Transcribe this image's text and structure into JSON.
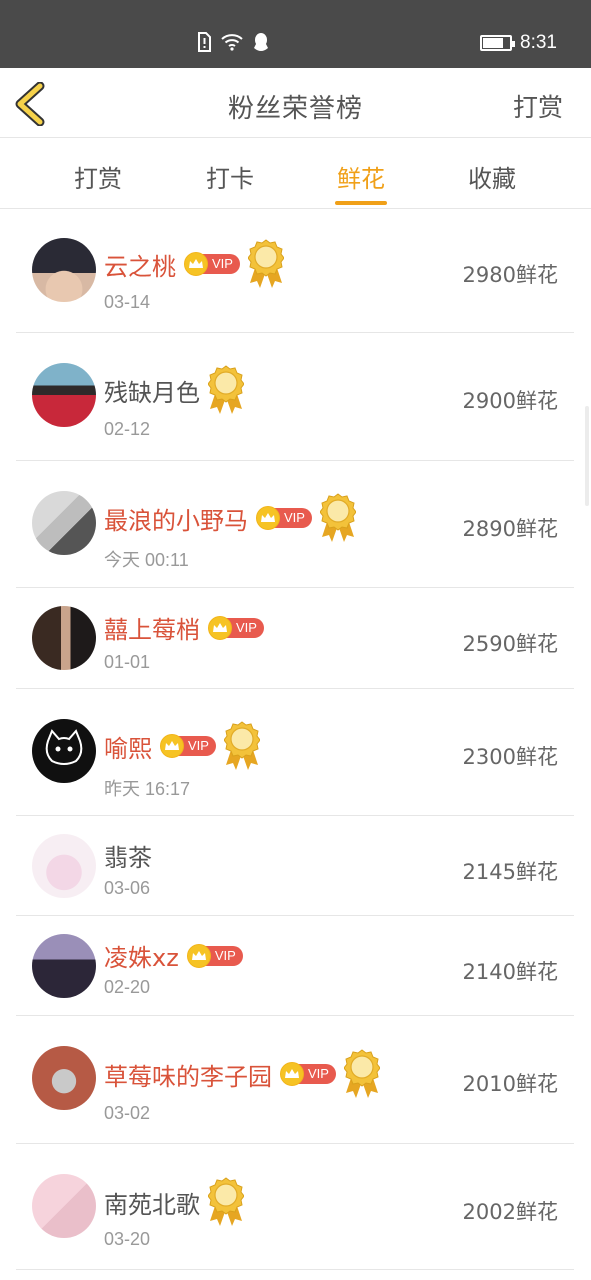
{
  "status_bar": {
    "time": "8:31"
  },
  "nav": {
    "title": "粉丝荣誉榜",
    "action": "打赏"
  },
  "tabs": [
    {
      "label": "打赏",
      "active": false
    },
    {
      "label": "打卡",
      "active": false
    },
    {
      "label": "鲜花",
      "active": true
    },
    {
      "label": "收藏",
      "active": false
    }
  ],
  "colors": {
    "accent": "#f0a018",
    "vip_name": "#d9533a",
    "vip_badge": "#e85a4e",
    "crown": "#f6c324"
  },
  "vip_label": "VIP",
  "rows": [
    {
      "name": "云之桃",
      "vip": true,
      "level": "lv5",
      "date": "03-14",
      "amount": "2980鲜花",
      "avatar": "avatar-dark-hair"
    },
    {
      "name": "残缺月色",
      "vip": false,
      "level": "lv4",
      "date": "02-12",
      "amount": "2900鲜花",
      "avatar": "avatar-red-dress"
    },
    {
      "name": "最浪的小野马",
      "vip": true,
      "level": "lv6",
      "date": "今天 00:11",
      "amount": "2890鲜花",
      "avatar": "avatar-hand"
    },
    {
      "name": "囍上莓梢",
      "vip": true,
      "level": "",
      "date": "01-01",
      "amount": "2590鲜花",
      "avatar": "avatar-couple"
    },
    {
      "name": "喻熙",
      "vip": true,
      "level": "lv4",
      "date": "昨天 16:17",
      "amount": "2300鲜花",
      "avatar": "avatar-black-cat"
    },
    {
      "name": "翡茶",
      "vip": false,
      "level": "",
      "date": "03-06",
      "amount": "2145鲜花",
      "avatar": "avatar-anime-girl"
    },
    {
      "name": "凌姝xz",
      "vip": true,
      "level": "",
      "date": "02-20",
      "amount": "2140鲜花",
      "avatar": "avatar-long-hair"
    },
    {
      "name": "草莓味的李子园",
      "vip": true,
      "level": "lv4",
      "date": "03-02",
      "amount": "2010鲜花",
      "avatar": "avatar-bunny"
    },
    {
      "name": "南苑北歌",
      "vip": false,
      "level": "lv3",
      "date": "03-20",
      "amount": "2002鲜花",
      "avatar": "avatar-pink-blur"
    }
  ]
}
